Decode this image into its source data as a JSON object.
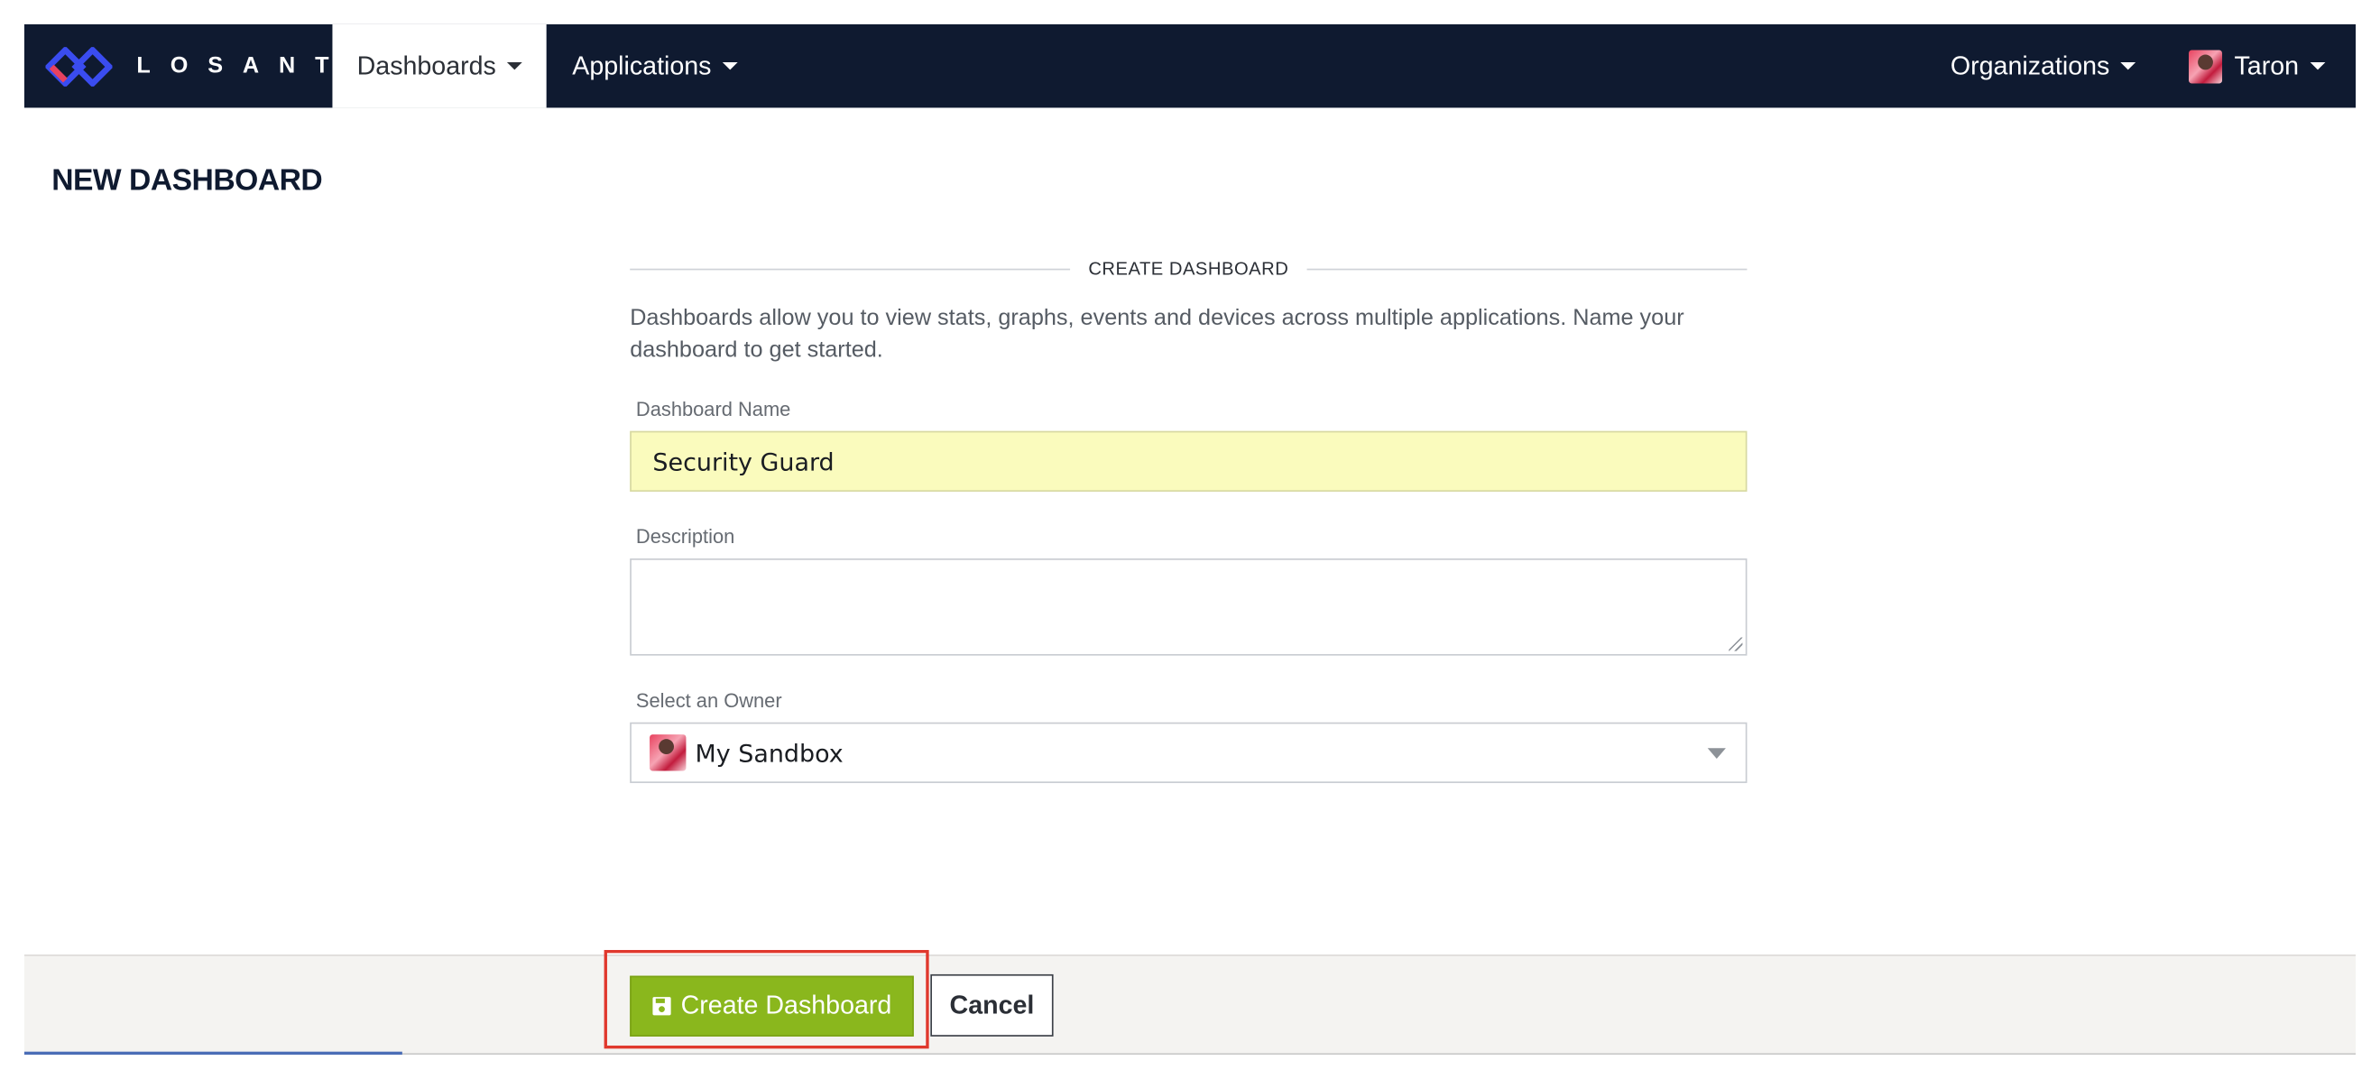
{
  "brand": {
    "name": "LOSANT",
    "logo_icon": "losant-diamond-logo"
  },
  "navbar": {
    "left_items": [
      {
        "label": "Dashboards",
        "active": true
      },
      {
        "label": "Applications",
        "active": false
      }
    ],
    "organizations_label": "Organizations",
    "user_label": "Taron"
  },
  "page": {
    "title": "NEW DASHBOARD"
  },
  "form": {
    "section_heading": "CREATE DASHBOARD",
    "intro_line1": "Dashboards allow you to view stats, graphs, events and devices across multiple applications. Name your",
    "intro_line2": "dashboard to get started.",
    "name_label": "Dashboard Name",
    "name_value": "Security Guard",
    "description_label": "Description",
    "description_value": "",
    "owner_label": "Select an Owner",
    "owner_value": "My Sandbox"
  },
  "footer": {
    "create_label": "Create Dashboard",
    "create_icon": "save-icon",
    "cancel_label": "Cancel"
  },
  "colors": {
    "navbar_bg": "#0f1a30",
    "primary_button": "#8ab71d",
    "highlight_box": "#e0382d",
    "autofill_bg": "#fafbbd"
  }
}
